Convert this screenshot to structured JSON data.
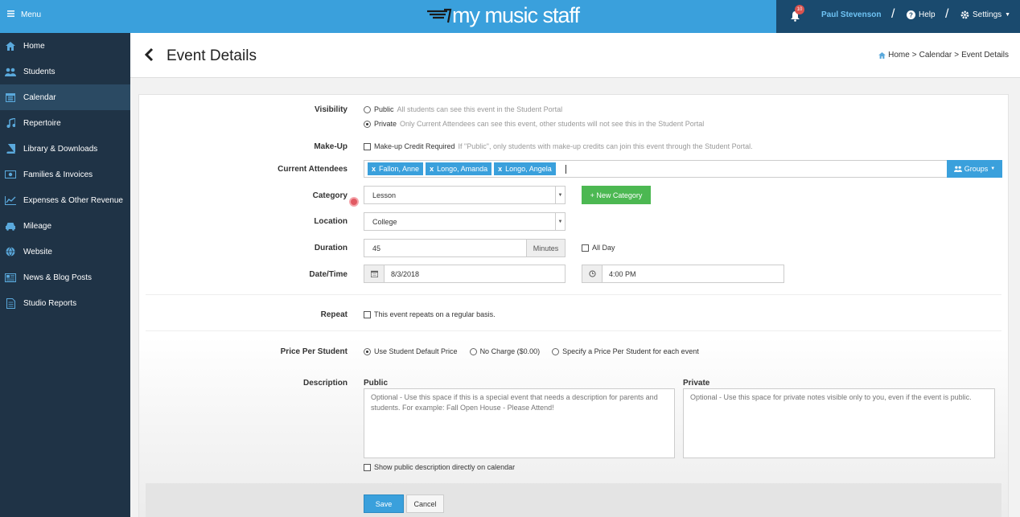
{
  "topbar": {
    "menu_label": "Menu",
    "logo_text": "my music staff",
    "notification_count": "10",
    "user_name": "Paul Stevenson",
    "help_label": "Help",
    "settings_label": "Settings"
  },
  "sidebar": {
    "items": [
      {
        "label": "Home",
        "icon": "home-icon"
      },
      {
        "label": "Students",
        "icon": "users-icon"
      },
      {
        "label": "Calendar",
        "icon": "calendar-icon"
      },
      {
        "label": "Repertoire",
        "icon": "music-note-icon"
      },
      {
        "label": "Library & Downloads",
        "icon": "book-icon"
      },
      {
        "label": "Families & Invoices",
        "icon": "money-icon"
      },
      {
        "label": "Expenses & Other Revenue",
        "icon": "chart-line-icon"
      },
      {
        "label": "Mileage",
        "icon": "car-icon"
      },
      {
        "label": "Website",
        "icon": "globe-icon"
      },
      {
        "label": "News & Blog Posts",
        "icon": "newspaper-icon"
      },
      {
        "label": "Studio Reports",
        "icon": "report-icon"
      }
    ],
    "active": "Calendar"
  },
  "page": {
    "title": "Event Details",
    "breadcrumb": {
      "home": "Home",
      "sep1": ">",
      "calendar": "Calendar",
      "sep2": ">",
      "current": "Event Details"
    }
  },
  "form": {
    "visibility": {
      "label": "Visibility",
      "public_label": "Public",
      "public_desc": "All students can see this event in the Student Portal",
      "private_label": "Private",
      "private_desc": "Only Current Attendees can see this event, other students will not see this in the Student Portal",
      "selected": "Private"
    },
    "makeup": {
      "label": "Make-Up",
      "checkbox_label": "Make-up Credit Required",
      "desc": "If \"Public\", only students with make-up credits can join this event through the Student Portal."
    },
    "attendees": {
      "label": "Current Attendees",
      "chips": [
        "Fallon, Anne",
        "Longo, Amanda",
        "Longo, Angela"
      ],
      "groups_label": "Groups"
    },
    "category": {
      "label": "Category",
      "value": "Lesson",
      "new_button": "+ New Category"
    },
    "location": {
      "label": "Location",
      "value": "College"
    },
    "duration": {
      "label": "Duration",
      "value": "45",
      "unit": "Minutes",
      "allday_label": "All Day"
    },
    "datetime": {
      "label": "Date/Time",
      "date": "8/3/2018",
      "time": "4:00 PM"
    },
    "repeat": {
      "label": "Repeat",
      "checkbox_label": "This event repeats on a regular basis."
    },
    "price": {
      "label": "Price Per Student",
      "options": [
        "Use Student Default Price",
        "No Charge ($0.00)",
        "Specify a Price Per Student for each event"
      ],
      "selected": "Use Student Default Price"
    },
    "description": {
      "label": "Description",
      "public_heading": "Public",
      "public_placeholder": "Optional - Use this space if this is a special event that needs a description for parents and students. For example: Fall Open House - Please Attend!",
      "private_heading": "Private",
      "private_placeholder": "Optional - Use this space for private notes visible only to you, even if the event is public.",
      "show_public_label": "Show public description directly on calendar"
    },
    "save_label": "Save",
    "cancel_label": "Cancel"
  },
  "colors": {
    "topbar": "#3aa0dc",
    "sidebar": "#1f3346",
    "accent_green": "#4cb852",
    "chip_blue": "#3aa0dc"
  }
}
